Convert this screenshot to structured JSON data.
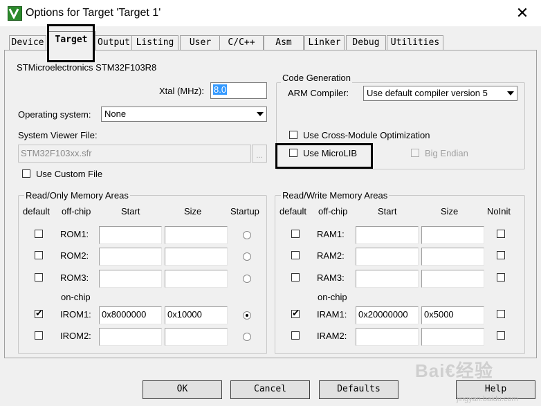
{
  "window": {
    "title": "Options for Target 'Target 1'",
    "close_glyph": "✕",
    "icon": "keil-uvision-icon"
  },
  "tabs": [
    {
      "label": "Device",
      "selected": false
    },
    {
      "label": "Target",
      "selected": true
    },
    {
      "label": "Output",
      "selected": false
    },
    {
      "label": "Listing",
      "selected": false
    },
    {
      "label": "User",
      "selected": false
    },
    {
      "label": "C/C++",
      "selected": false
    },
    {
      "label": "Asm",
      "selected": false
    },
    {
      "label": "Linker",
      "selected": false
    },
    {
      "label": "Debug",
      "selected": false
    },
    {
      "label": "Utilities",
      "selected": false
    }
  ],
  "target": {
    "device_name": "STMicroelectronics STM32F103R8",
    "xtal_label": "Xtal (MHz):",
    "xtal_value": "8.0",
    "os_label": "Operating system:",
    "os_value": "None",
    "svf_label": "System Viewer File:",
    "svf_value": "STM32F103xx.sfr",
    "svf_browse": "...",
    "custom_file_label": "Use Custom File",
    "custom_file_checked": false
  },
  "code_generation": {
    "title": "Code Generation",
    "compiler_label": "ARM Compiler:",
    "compiler_value": "Use default compiler version 5",
    "cross_module_label": "Use Cross-Module Optimization",
    "cross_module_checked": false,
    "microlib_label": "Use MicroLIB",
    "microlib_checked": false,
    "big_endian_label": "Big Endian",
    "big_endian_checked": false
  },
  "ro_memory": {
    "title": "Read/Only Memory Areas",
    "headers": {
      "default": "default",
      "offchip": "off-chip",
      "start": "Start",
      "size": "Size",
      "extra": "Startup"
    },
    "onchip_label": "on-chip",
    "rows": [
      {
        "name": "ROM1:",
        "default": false,
        "start": "",
        "size": "",
        "startup": false
      },
      {
        "name": "ROM2:",
        "default": false,
        "start": "",
        "size": "",
        "startup": false
      },
      {
        "name": "ROM3:",
        "default": false,
        "start": "",
        "size": "",
        "startup": false
      },
      {
        "name": "IROM1:",
        "default": true,
        "start": "0x8000000",
        "size": "0x10000",
        "startup": true
      },
      {
        "name": "IROM2:",
        "default": false,
        "start": "",
        "size": "",
        "startup": false
      }
    ]
  },
  "rw_memory": {
    "title": "Read/Write Memory Areas",
    "headers": {
      "default": "default",
      "offchip": "off-chip",
      "start": "Start",
      "size": "Size",
      "extra": "NoInit"
    },
    "onchip_label": "on-chip",
    "rows": [
      {
        "name": "RAM1:",
        "default": false,
        "start": "",
        "size": "",
        "noinit": false
      },
      {
        "name": "RAM2:",
        "default": false,
        "start": "",
        "size": "",
        "noinit": false
      },
      {
        "name": "RAM3:",
        "default": false,
        "start": "",
        "size": "",
        "noinit": false
      },
      {
        "name": "IRAM1:",
        "default": true,
        "start": "0x20000000",
        "size": "0x5000",
        "noinit": false
      },
      {
        "name": "IRAM2:",
        "default": false,
        "start": "",
        "size": "",
        "noinit": false
      }
    ]
  },
  "buttons": {
    "ok": "OK",
    "cancel": "Cancel",
    "defaults": "Defaults",
    "help": "Help"
  },
  "watermark": {
    "brand": "Bai€经验",
    "url": "jingyan.baidu.com"
  },
  "colors": {
    "selection": "#3399ff",
    "dialog_bg": "#f0f0f0",
    "highlight_box": "#000000"
  }
}
